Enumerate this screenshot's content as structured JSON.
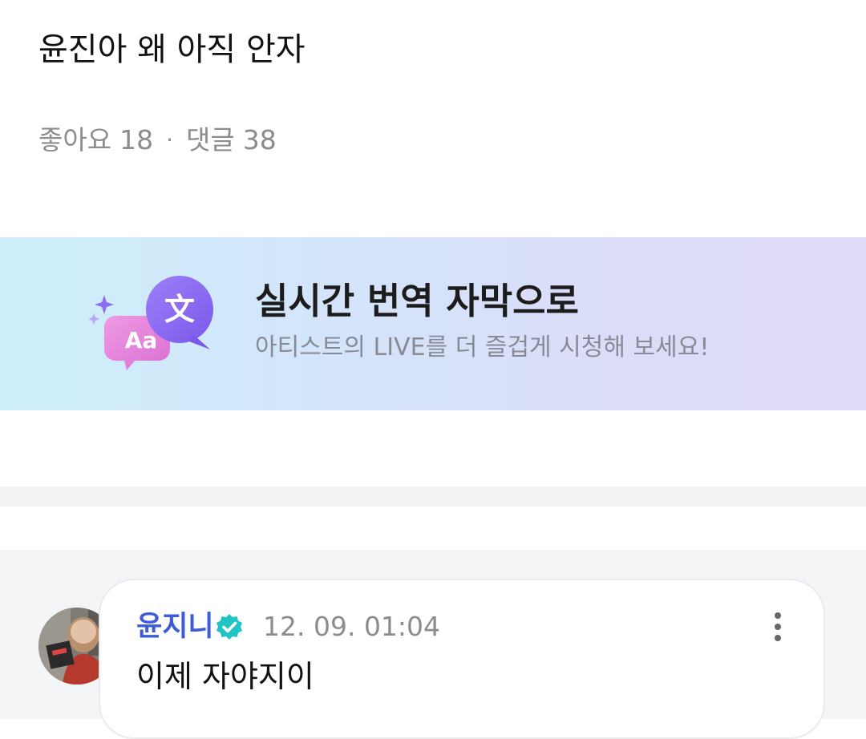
{
  "post": {
    "title": "윤진아 왜 아직 안자",
    "likes_label": "좋아요",
    "likes_count": "18",
    "separator": "·",
    "comments_label": "댓글",
    "comments_count": "38"
  },
  "banner": {
    "title": "실시간 번역 자막으로",
    "subtitle": "아티스트의 LIVE를 더 즐겁게 시청해 보세요!",
    "icon_glyph_translated": "文",
    "icon_glyph_source": "Aa",
    "accent_purple": "#8b67ef",
    "accent_pink": "#e27cd8"
  },
  "comment": {
    "author": "윤지니",
    "verified_color": "#20c4c4",
    "time": "12. 09. 01:04",
    "text": "이제 자야지이",
    "author_color": "#3d5cd6"
  }
}
